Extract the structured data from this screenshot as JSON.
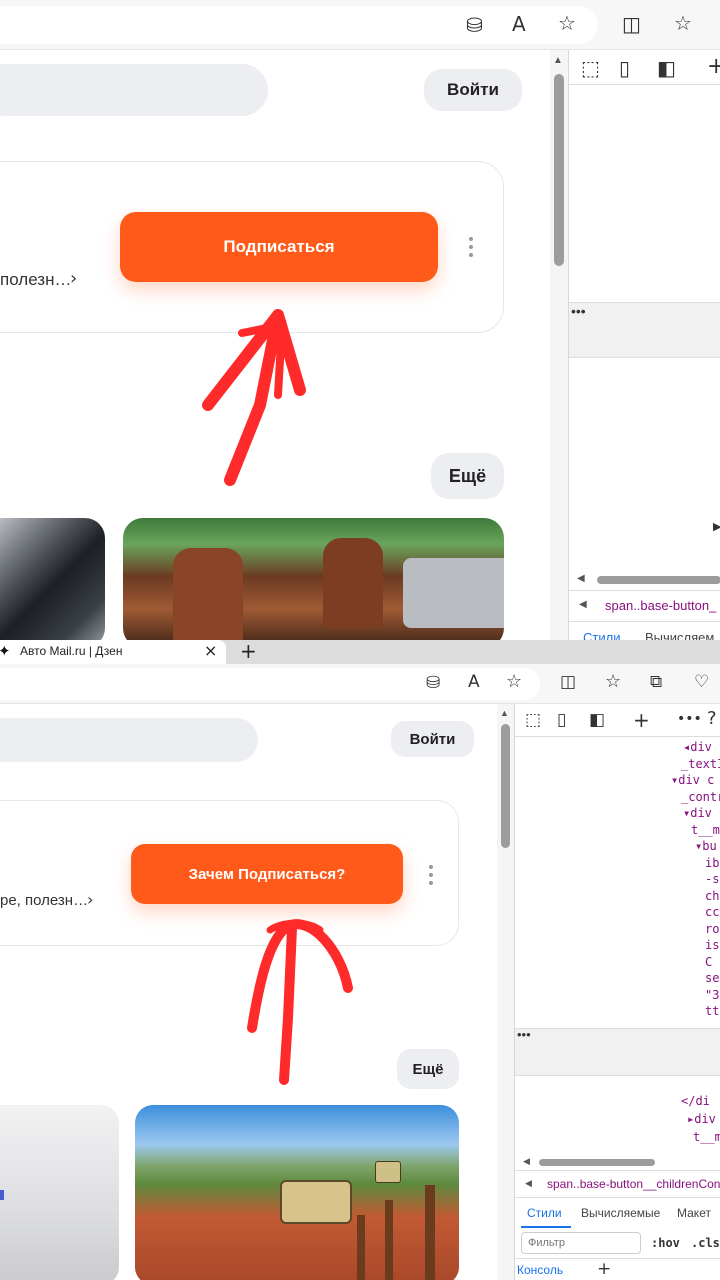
{
  "top": {
    "login_button": "Войти",
    "subscribe_button": "Подписаться",
    "card_text": "полезн…",
    "more_button": "Ещё",
    "devtools_breadcrumb": "span..base-button_",
    "devtools_tab_styles": "Стили",
    "devtools_tab_computed": "Вычисляем"
  },
  "bottom": {
    "tab_title": "Авто Mail.ru | Дзен",
    "login_button": "Войти",
    "subscribe_button": "Зачем Подписаться?",
    "card_text": "ре, полезн…",
    "more_button": "Ещё",
    "devtools_code": [
      "◂div c",
      "_textI",
      "▾div c",
      "_contr",
      "▾div",
      "t__m",
      "▾bu",
      "ibe",
      "-su",
      "cha",
      "cce",
      "roo",
      "isR",
      "C",
      "se",
      "\"За",
      "tto"
    ],
    "devtools_code_lower": [
      "</di",
      "▸div",
      "t__m"
    ],
    "devtools_breadcrumb": "span..base-button__childrenCont",
    "devtools_tabs": [
      "Стили",
      "Вычисляемые",
      "Макет"
    ],
    "filter_placeholder": "Фильтр",
    "hov": ":hov",
    "cls": ".cls",
    "console_label": "Консоль"
  },
  "icons": [
    "close-icon",
    "plus-icon",
    "reader-icon",
    "star-icon",
    "favorites-icon",
    "split-icon",
    "inspect-icon",
    "device-icon",
    "sidebar-icon",
    "more-icon",
    "help-icon",
    "chevron-right-icon"
  ],
  "colors": {
    "accent": "#ff5a1a",
    "annotation": "#ff2a2a",
    "pill": "#eceef1"
  }
}
